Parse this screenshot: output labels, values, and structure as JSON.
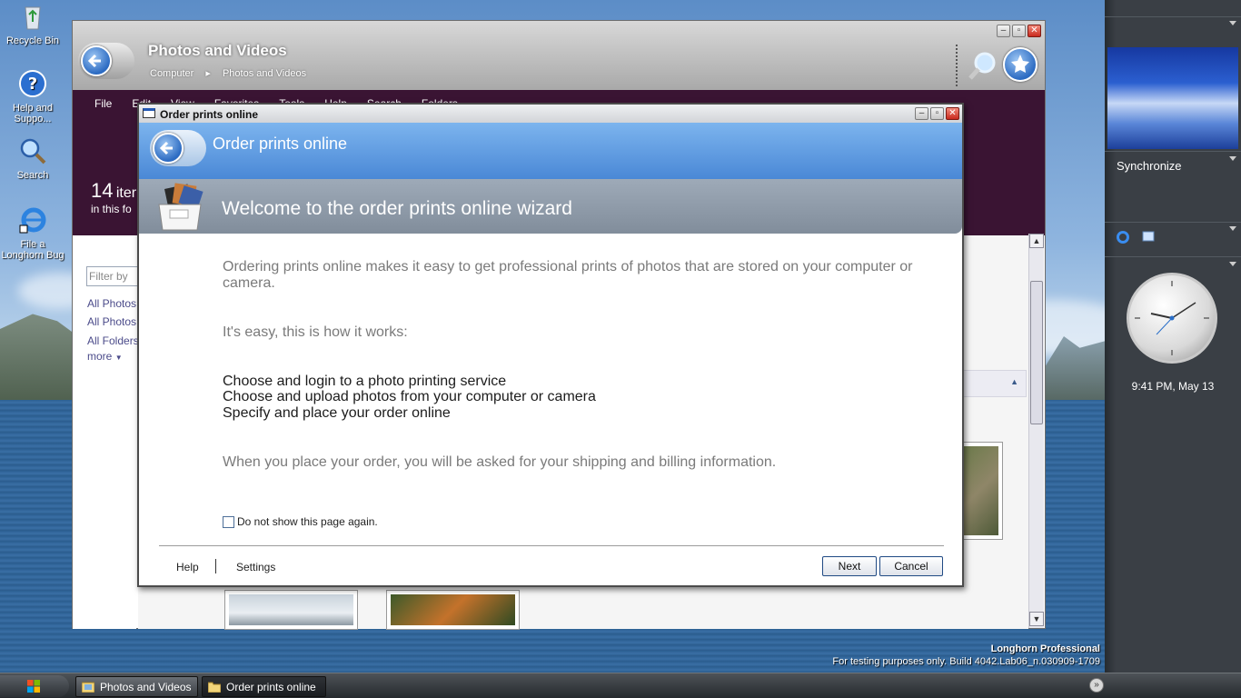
{
  "desktop": {
    "icons": [
      {
        "label": "Recycle Bin"
      },
      {
        "label": "Help and Suppo..."
      },
      {
        "label": "Search"
      },
      {
        "label": "File a Longhorn Bug"
      }
    ],
    "watermark": {
      "edition": "Longhorn Professional",
      "build": "For testing purposes only. Build 4042.Lab06_n.030909-1709"
    }
  },
  "explorer": {
    "title": "Photos and Videos",
    "breadcrumb": [
      "Computer",
      "Photos and Videos"
    ],
    "menu": [
      "File",
      "Edit",
      "View",
      "Favorites",
      "Tools",
      "Help"
    ],
    "toolbar": [
      "Search",
      "Folders"
    ],
    "item_count": {
      "number": "14",
      "word": "iter",
      "sub": "in this fo"
    },
    "filter_placeholder": "Filter by",
    "side_links": [
      "All Photos",
      "All Photos",
      "All Folders",
      "more"
    ]
  },
  "wizard": {
    "window_title": "Order prints online",
    "header_title": "Order prints online",
    "band_title": "Welcome to the order prints online wizard",
    "intro": "Ordering prints online makes it easy to get professional prints of photos that are stored on your computer or camera.",
    "easy_line": "It's easy, this is how it works:",
    "steps": [
      "Choose and login to a photo printing service",
      "Choose and upload photos from your computer or camera",
      "Specify and place your order online"
    ],
    "shipping_note": "When you place your order, you will be asked for your shipping and billing information.",
    "checkbox_label": "Do not show this page again.",
    "checkbox_checked": false,
    "links": {
      "help": "Help",
      "settings": "Settings"
    },
    "buttons": {
      "next": "Next",
      "cancel": "Cancel"
    }
  },
  "sidebar": {
    "sync_label": "Synchronize",
    "clock_time": "9:41 PM, May 13"
  },
  "taskbar": {
    "tasks": [
      {
        "label": "Photos and Videos"
      },
      {
        "label": "Order prints online"
      }
    ]
  },
  "colors": {
    "wizard_header": "#4a88d6",
    "explorer_band": "#3a1433",
    "sidebar": "#3a3f45"
  }
}
